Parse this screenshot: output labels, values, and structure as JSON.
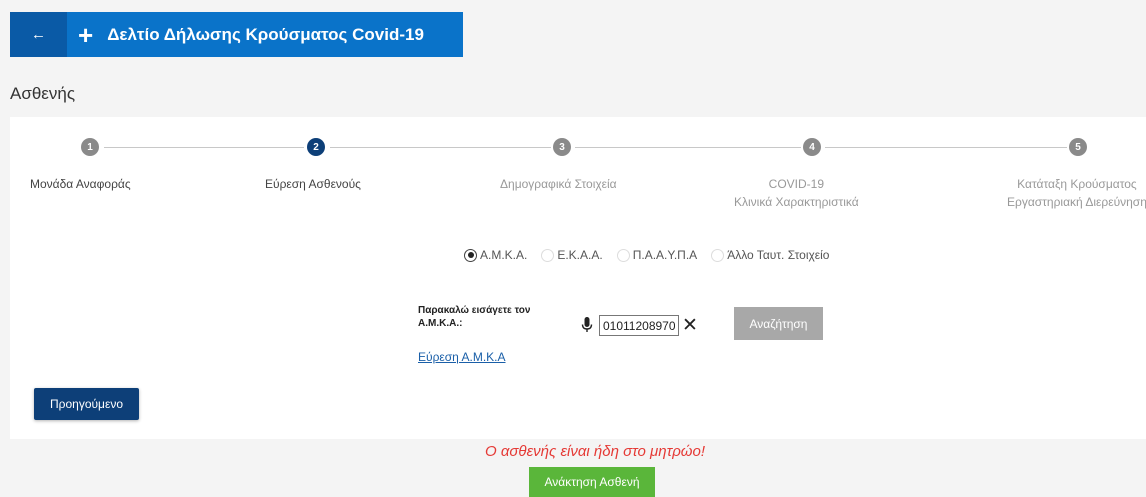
{
  "header": {
    "back_icon": "←",
    "add_icon": "+",
    "title": "Δελτίο Δήλωσης Κρούσματος Covid-19"
  },
  "page_title": "Ασθενής",
  "stepper": {
    "steps": [
      {
        "number": "1",
        "label": "Μονάδα Αναφοράς",
        "label2": ""
      },
      {
        "number": "2",
        "label": "Εύρεση Ασθενούς",
        "label2": ""
      },
      {
        "number": "3",
        "label": "Δημογραφικά Στοιχεία",
        "label2": ""
      },
      {
        "number": "4",
        "label": "COVID-19",
        "label2": "Κλινικά Χαρακτηριστικά"
      },
      {
        "number": "5",
        "label": "Κατάταξη Κρούσματος",
        "label2": "Εργαστηριακή Διερεύνηση"
      }
    ],
    "active_step": 2
  },
  "id_type": {
    "options": [
      "Α.Μ.Κ.Α.",
      "Ε.Κ.Α.Α.",
      "Π.Α.Α.Υ.Π.Α",
      "Άλλο Ταυτ. Στοιχείο"
    ],
    "selected": "Α.Μ.Κ.Α."
  },
  "amka": {
    "label_line1": "Παρακαλώ εισάγετε τον",
    "label_line2": "Α.Μ.Κ.Α.:",
    "value": "01011208970",
    "clear_icon": "✕",
    "search_label": "Αναζήτηση",
    "find_link": "Εύρεση Α.Μ.Κ.Α"
  },
  "nav": {
    "previous_label": "Προηγούμενο"
  },
  "status": {
    "message": "Ο ασθενής είναι ήδη στο μητρώο!",
    "recall_label": "Ανάκτηση Ασθενή"
  },
  "colors": {
    "header_bg": "#0a73c9",
    "primary_dark": "#0d3f78",
    "error": "#e53935",
    "success": "#5ab63a"
  }
}
